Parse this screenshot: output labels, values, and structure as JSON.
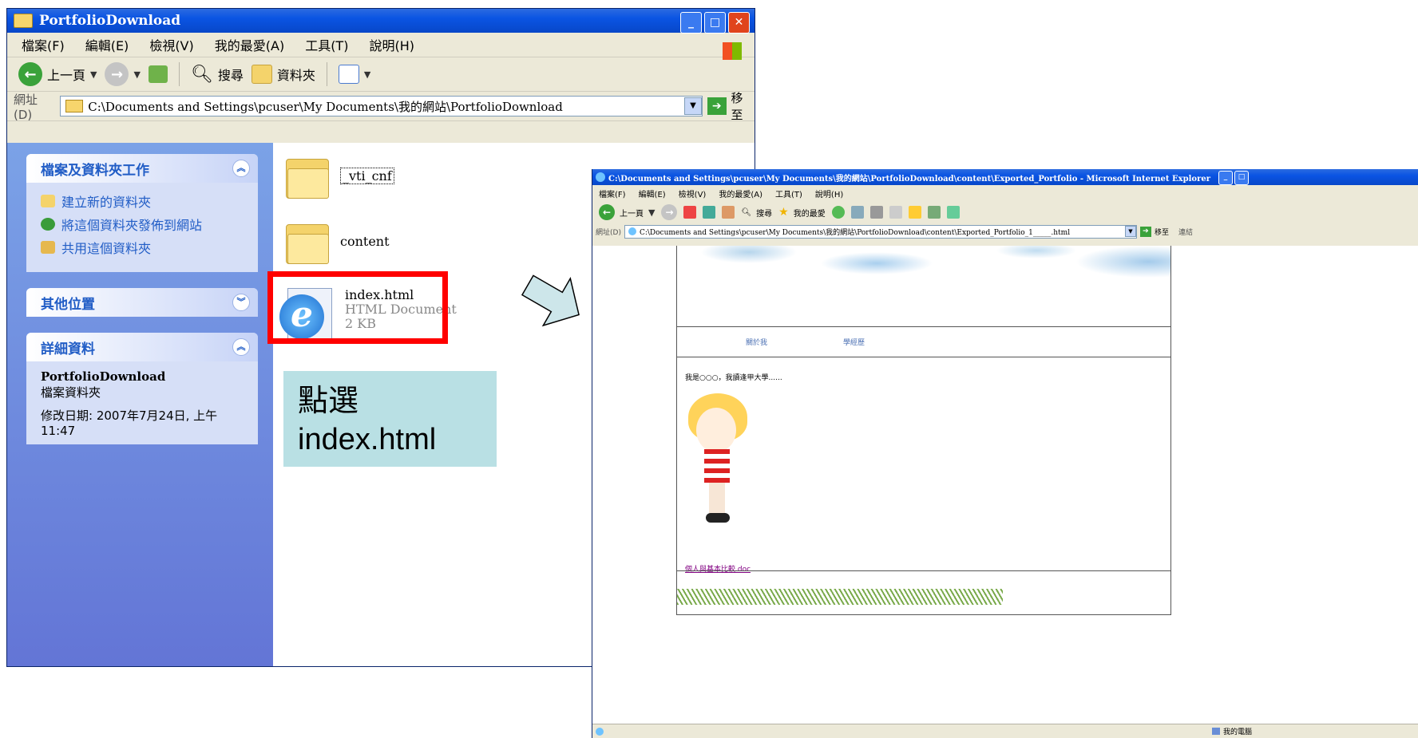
{
  "explorer": {
    "title": "PortfolioDownload",
    "menu": [
      "檔案(F)",
      "編輯(E)",
      "檢視(V)",
      "我的最愛(A)",
      "工具(T)",
      "說明(H)"
    ],
    "toolbar": {
      "back": "上一頁",
      "search": "搜尋",
      "folders": "資料夾"
    },
    "address": {
      "label": "網址(D)",
      "path": "C:\\Documents and Settings\\pcuser\\My Documents\\我的網站\\PortfolioDownload",
      "go": "移至"
    },
    "tasks_panel": {
      "title": "檔案及資料夾工作",
      "items": [
        "建立新的資料夾",
        "將這個資料夾發佈到網站",
        "共用這個資料夾"
      ]
    },
    "other_places_title": "其他位置",
    "details_panel": {
      "title": "詳細資料",
      "name": "PortfolioDownload",
      "type": "檔案資料夾",
      "modified": "修改日期: 2007年7月24日, 上午 11:47"
    },
    "files": [
      {
        "name": "_vti_cnf"
      },
      {
        "name": "content"
      },
      {
        "name": "index.html",
        "type": "HTML Document",
        "size": "2 KB"
      }
    ]
  },
  "callout": {
    "line1": "點選",
    "line2": "index.html"
  },
  "ie": {
    "title": "C:\\Documents and Settings\\pcuser\\My Documents\\我的網站\\PortfolioDownload\\content\\Exported_Portfolio - Microsoft Internet Explorer",
    "menu": [
      "檔案(F)",
      "編輯(E)",
      "檢視(V)",
      "我的最愛(A)",
      "工具(T)",
      "說明(H)"
    ],
    "toolbar": {
      "back": "上一頁",
      "search": "搜尋",
      "favorites": "我的最愛"
    },
    "address": {
      "label": "網址(D)",
      "path": "C:\\Documents and Settings\\pcuser\\My Documents\\我的網站\\PortfolioDownload\\content\\Exported_Portfolio_1_____.html",
      "go": "移至",
      "links": "連結"
    },
    "page": {
      "nav": [
        "關於我",
        "學經歷"
      ],
      "intro": "我是○○○，我讀逢甲大學......",
      "link": "個人與基本比較.doc"
    },
    "status": {
      "zone": "我的電腦"
    }
  }
}
